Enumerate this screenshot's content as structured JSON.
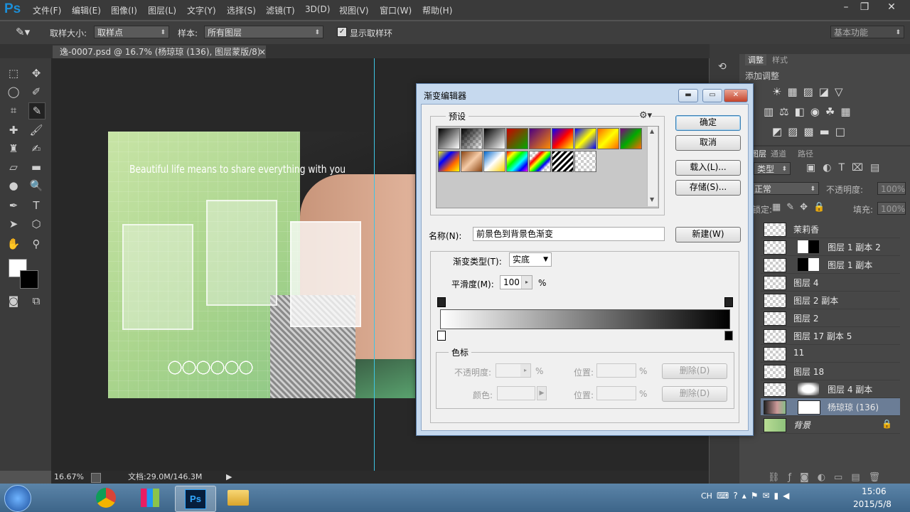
{
  "app": {
    "logo": "Ps",
    "menus": [
      "文件(F)",
      "编辑(E)",
      "图像(I)",
      "图层(L)",
      "文字(Y)",
      "选择(S)",
      "滤镜(T)",
      "3D(D)",
      "视图(V)",
      "窗口(W)",
      "帮助(H)"
    ]
  },
  "options": {
    "sample_size_label": "取样大小:",
    "sample_size_value": "取样点",
    "sample_label": "样本:",
    "sample_value": "所有图层",
    "show_ring_label": "显示取样环",
    "workspace": "基本功能"
  },
  "document": {
    "tab_title": "逸-0007.psd @ 16.7% (杨琼琼 (136), 图层蒙版/8) *",
    "canvas_text": "Beautiful life means to share everything with you",
    "zoom": "16.67%",
    "doc_info": "文档:29.0M/146.3M"
  },
  "adjustments": {
    "tab_adjust": "调整",
    "tab_style": "样式",
    "add_label": "添加调整"
  },
  "layers": {
    "tabs": [
      "图层",
      "通道",
      "路径"
    ],
    "kind_label": "类型",
    "blend_mode": "正常",
    "opacity_label": "不透明度:",
    "opacity_value": "100%",
    "lock_label": "锁定:",
    "fill_label": "填充:",
    "fill_value": "100%",
    "items": [
      {
        "name": "茉莉香"
      },
      {
        "name": "图层 1 副本 2"
      },
      {
        "name": "图层 1 副本"
      },
      {
        "name": "图层 4"
      },
      {
        "name": "图层 2 副本"
      },
      {
        "name": "图层 2"
      },
      {
        "name": "图层 17 副本 5"
      },
      {
        "name": "11"
      },
      {
        "name": "图层 18"
      },
      {
        "name": "图层 4 副本"
      },
      {
        "name": "杨琼琼 (136)"
      },
      {
        "name": "背景"
      }
    ],
    "selected_index": 10
  },
  "dialog": {
    "title": "渐变编辑器",
    "presets_label": "预设",
    "ok": "确定",
    "cancel": "取消",
    "load": "载入(L)...",
    "save": "存储(S)...",
    "name_label": "名称(N):",
    "name_value": "前景色到背景色渐变",
    "new": "新建(W)",
    "gradient_type_label": "渐变类型(T):",
    "gradient_type_value": "实底",
    "smoothness_label": "平滑度(M):",
    "smoothness_value": "100",
    "percent": "%",
    "stops_label": "色标",
    "opacity_label": "不透明度:",
    "color_label": "颜色:",
    "location_label": "位置:",
    "delete": "删除(D)"
  },
  "taskbar": {
    "lang": "CH",
    "time": "15:06",
    "date": "2015/5/8"
  }
}
